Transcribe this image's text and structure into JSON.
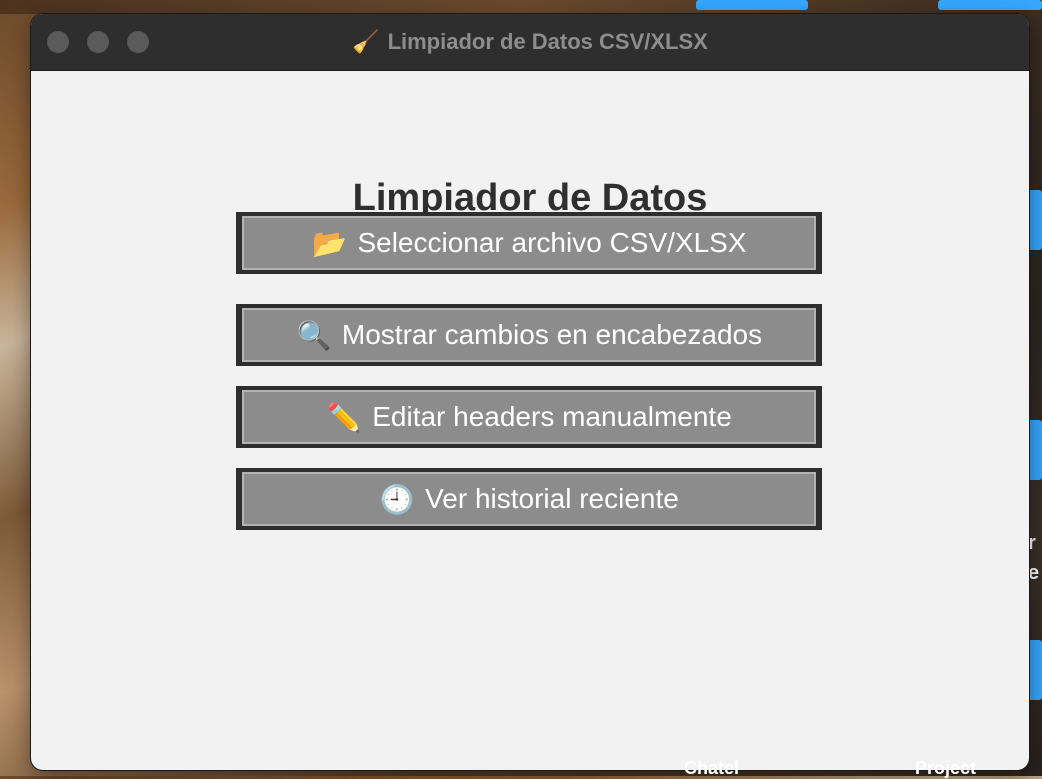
{
  "window": {
    "title": "Limpiador de Datos CSV/XLSX",
    "title_icon": "broom-icon"
  },
  "main": {
    "heading": "Limpiador de Datos",
    "buttons": [
      {
        "label": "Seleccionar archivo CSV/XLSX",
        "icon": "folder-icon",
        "glyph": "📂"
      },
      {
        "label": "Mostrar cambios en encabezados",
        "icon": "magnifier-icon",
        "glyph": "🔍"
      },
      {
        "label": "Editar headers manualmente",
        "icon": "pencil-icon",
        "glyph": "✏️"
      },
      {
        "label": "Ver historial reciente",
        "icon": "clock-icon",
        "glyph": "🕘"
      }
    ]
  },
  "desktop": {
    "labels": [
      "Chatel",
      "Project",
      "r",
      "e"
    ]
  },
  "colors": {
    "titlebar": "#2e2e2e",
    "window_bg": "#f2f2f2",
    "button_face": "#8c8c8c",
    "button_border": "#2e2e2e",
    "desktop_tile": "#36a8ff"
  }
}
